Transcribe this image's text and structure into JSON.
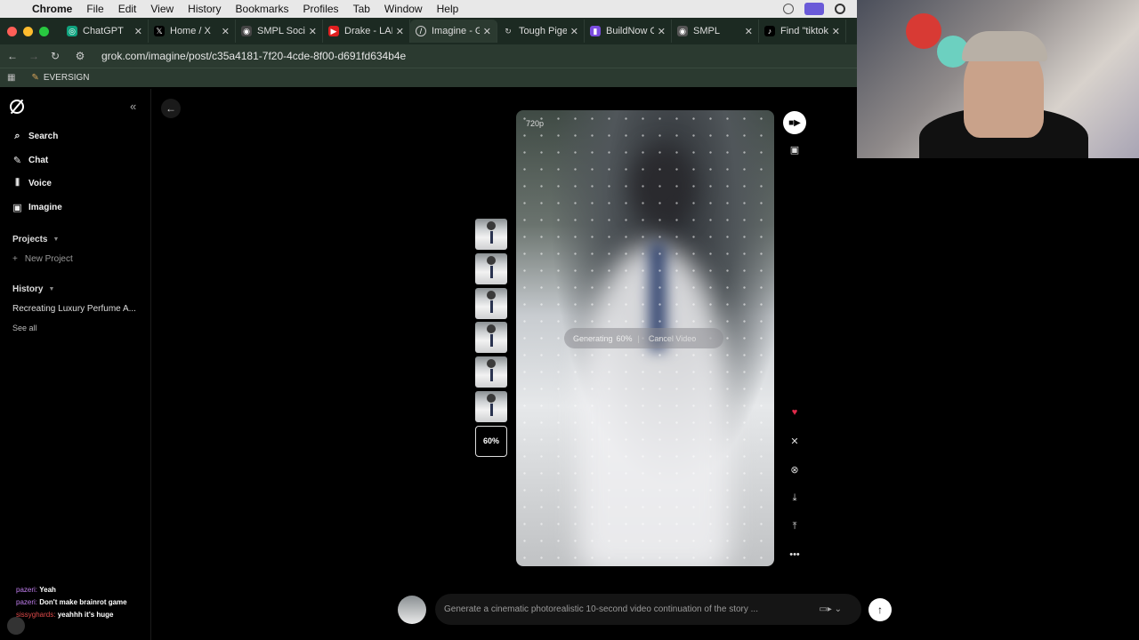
{
  "menubar": {
    "app": "Chrome",
    "items": [
      "File",
      "Edit",
      "View",
      "History",
      "Bookmarks",
      "Profiles",
      "Tab",
      "Window",
      "Help"
    ]
  },
  "tabs": [
    {
      "label": "ChatGPT",
      "icon": "chatgpt-icon"
    },
    {
      "label": "Home / X",
      "icon": "x-icon"
    },
    {
      "label": "SMPL Social",
      "icon": "smpl-icon"
    },
    {
      "label": "Drake - LANE",
      "icon": "youtube-icon"
    },
    {
      "label": "Imagine - Gro",
      "icon": "grok-icon",
      "active": true
    },
    {
      "label": "Tough Pigeon",
      "icon": "pigeon-icon"
    },
    {
      "label": "BuildNow GG",
      "icon": "twitch-icon"
    },
    {
      "label": "SMPL",
      "icon": "smpl-icon"
    },
    {
      "label": "Find \"tiktokm",
      "icon": "tiktok-icon"
    }
  ],
  "address": {
    "url": "grok.com/imagine/post/c35a4181-7f20-4cde-8f00-d691fd634b4e"
  },
  "bookmarks": {
    "items": [
      "EVERSIGN"
    ]
  },
  "sidebar": {
    "nav": [
      {
        "label": "Search",
        "icon": "search-icon"
      },
      {
        "label": "Chat",
        "icon": "chat-icon"
      },
      {
        "label": "Voice",
        "icon": "voice-icon"
      },
      {
        "label": "Imagine",
        "icon": "imagine-icon"
      }
    ],
    "projects_label": "Projects",
    "new_project_label": "New Project",
    "history_label": "History",
    "history_items": [
      "Recreating Luxury Perfume A..."
    ],
    "see_all_label": "See all"
  },
  "chat_overlay": [
    {
      "user": "pazeri:",
      "message": "Yeah"
    },
    {
      "user": "pazeri:",
      "message": "Don't make brainrot game"
    },
    {
      "user": "sissyghards:",
      "message": "yeahhh it's huge"
    }
  ],
  "video": {
    "resolution_label": "720p",
    "progress_percent": 60,
    "progress_label": "60%",
    "generating_label": "Generating",
    "cancel_label": "Cancel Video"
  },
  "thumbnails": {
    "count": 6,
    "progress_label": "60%"
  },
  "prompt": {
    "placeholder": "Generate a cinematic photorealistic 10-second video continuation of the story ..."
  },
  "colors": {
    "tabbar_bg": "#1c2a22",
    "accent_heart": "#e02a4a",
    "background": "#000000"
  }
}
